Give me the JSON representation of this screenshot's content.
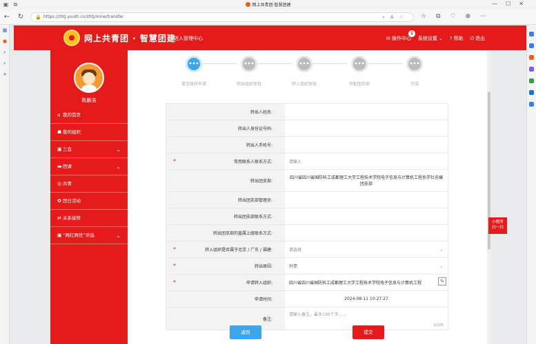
{
  "browser": {
    "tab_title": "网上共青团·智慧团建",
    "url": "https://zhtj.youth.cn/zhtj/mine/transfer"
  },
  "header": {
    "brand": "网上共青团 · 智慧团建",
    "sub_brand": "进入管理中心",
    "messages_label": "操作中心",
    "messages_count": "1",
    "settings_label": "系统设置",
    "help_label": "帮助",
    "logout_label": "退出"
  },
  "sidebar": {
    "username": "陈鹏浩",
    "items": [
      {
        "label": "我的首页",
        "icon": "home-icon",
        "has_children": false
      },
      {
        "label": "我的组织",
        "icon": "org-icon",
        "has_children": false
      },
      {
        "label": "三会",
        "icon": "meeting-icon",
        "has_children": true
      },
      {
        "label": "团课",
        "icon": "course-icon",
        "has_children": true
      },
      {
        "label": "共青",
        "icon": "league-icon",
        "has_children": false
      },
      {
        "label": "团日活动",
        "icon": "activity-icon",
        "has_children": false
      },
      {
        "label": "关系接转",
        "icon": "transfer-icon",
        "has_children": false
      },
      {
        "label": "“两红两优”评选",
        "icon": "award-icon",
        "has_children": true
      }
    ]
  },
  "steps": [
    {
      "label": "提交接转申请",
      "active": true
    },
    {
      "label": "转出组织审批",
      "active": false
    },
    {
      "label": "转入组织审批",
      "active": false
    },
    {
      "label": "待配团支部",
      "active": false
    },
    {
      "label": "完成",
      "active": false
    }
  ],
  "form": {
    "rows": [
      {
        "label": "转出人姓名:",
        "value": "",
        "required": false
      },
      {
        "label": "转出人身份证号码:",
        "value": "",
        "required": false
      },
      {
        "label": "转出人手机号:",
        "value": "",
        "required": false
      },
      {
        "label": "常用联系人联系方式:",
        "value": "请输入",
        "required": true
      },
      {
        "label": "转出团支部:",
        "value": "四川省四川省国防科工成都理工大学工程技术学院电子信息与计算机工程系学社充编团支部",
        "required": false
      },
      {
        "label": "转出团支部管理员:",
        "value": "",
        "required": false
      },
      {
        "label": "转出团支部联系方式:",
        "value": "",
        "required": false
      },
      {
        "label": "转出团支部的直属上级联系方式:",
        "value": "",
        "required": false
      },
      {
        "label": "转入组织是否属于北京 / 广东 / 福建:",
        "value": "请选择",
        "required": true
      },
      {
        "label": "转出原因:",
        "value": "升学",
        "required": true
      },
      {
        "label": "申请转入组织:",
        "value": "四川省四川省国防科工成都理工大学工程技术学院电子信息与计算机工程",
        "required": true
      },
      {
        "label": "申请时间:",
        "value": "2024-08-11 10:27:27",
        "required": false
      },
      {
        "label": "备注:",
        "value": "请输入备注，最多100个字……",
        "required": false
      }
    ],
    "remark_counter": "0/100",
    "back_label": "返回",
    "submit_label": "提交"
  },
  "float_qr": {
    "line1": "小程序",
    "line2": "扫一扫"
  },
  "colors": {
    "brand_red": "#e31b1b",
    "accent_blue": "#3ca5ec"
  }
}
